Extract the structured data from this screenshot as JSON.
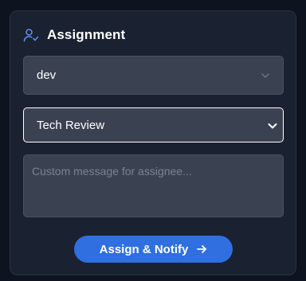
{
  "panel": {
    "title": "Assignment",
    "title_icon": "user-check-icon"
  },
  "assignee_select": {
    "value": "dev",
    "icon": "chevron-down-icon"
  },
  "template_select": {
    "value": "Tech Review",
    "icon": "chevron-down-icon"
  },
  "message": {
    "placeholder": "Custom message for assignee..."
  },
  "assign_button": {
    "label": "Assign & Notify",
    "icon": "arrow-right-icon"
  },
  "colors": {
    "page_bg": "#0e1320",
    "panel_bg": "#1a2130",
    "field_bg": "#3a4252",
    "accent": "#2f6fe0",
    "icon_accent": "#5b8def"
  }
}
